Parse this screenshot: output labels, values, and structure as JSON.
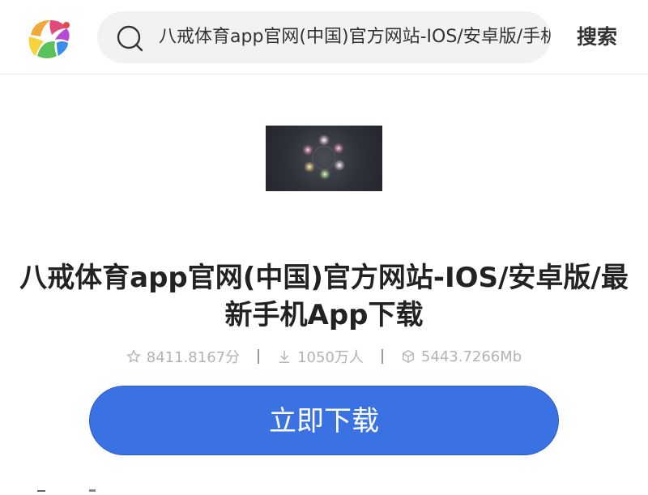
{
  "header": {
    "logo_icon": "colorful-petal-logo-icon",
    "search": {
      "icon": "search-icon",
      "value": "八戒体育app官网(中国)官方网站-IOS/安卓版/手机App下载"
    },
    "search_button_label": "搜索"
  },
  "app": {
    "image_icon": "app-screenshot-orbs",
    "title": "八戒体育app官网(中国)官方网站-IOS/安卓版/最新手机App下载",
    "rating": "8411.8167分",
    "downloads": "1050万人",
    "size": "5443.7266Mb",
    "download_button_label": "立即下载"
  },
  "colors": {
    "accent": "#3a72e3",
    "meta_text": "#b3b3b3"
  }
}
